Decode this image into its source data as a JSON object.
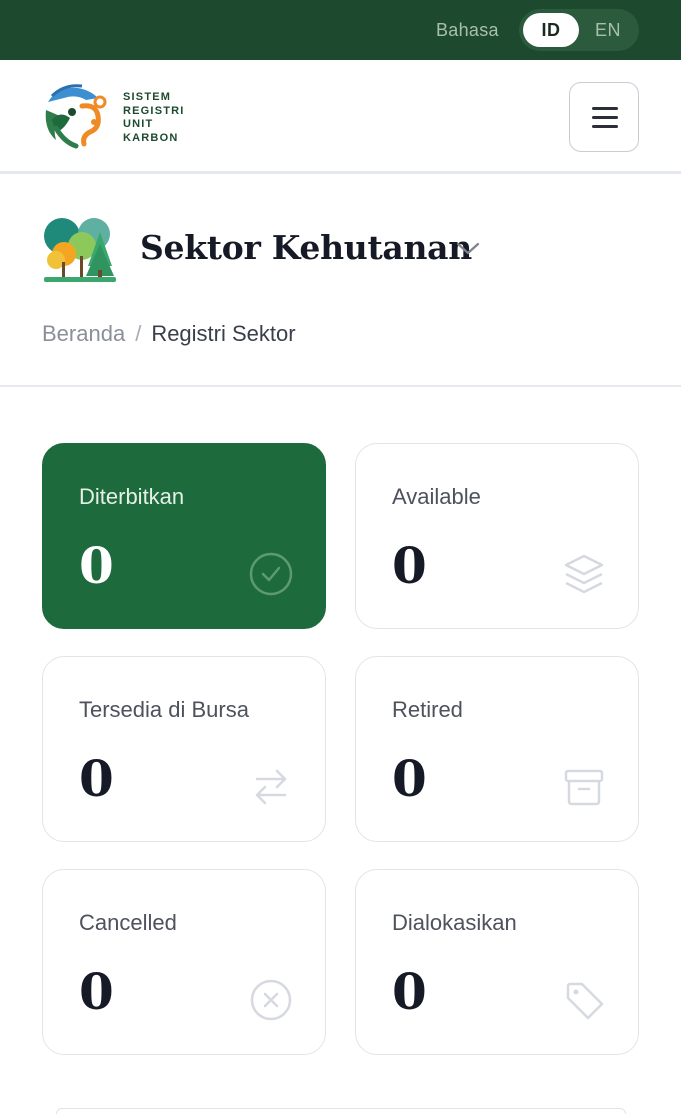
{
  "topbar": {
    "language_label": "Bahasa",
    "languages": [
      {
        "code": "ID",
        "active": true
      },
      {
        "code": "EN",
        "active": false
      }
    ]
  },
  "header": {
    "logo_lines": [
      "SISTEM",
      "REGISTRI",
      "UNIT",
      "KARBON"
    ],
    "menu_icon": "hamburger-icon"
  },
  "sector": {
    "title": "Sektor Kehutanan",
    "icon": "forest-trees-icon",
    "dropdown_icon": "chevron-down-icon"
  },
  "breadcrumb": {
    "home": "Beranda",
    "separator": "/",
    "current": "Registri Sektor"
  },
  "stats": [
    {
      "label": "Diterbitkan",
      "value": "0",
      "icon": "check-circle-icon"
    },
    {
      "label": "Available",
      "value": "0",
      "icon": "layers-icon"
    },
    {
      "label": "Tersedia di Bursa",
      "value": "0",
      "icon": "swap-arrows-icon"
    },
    {
      "label": "Retired",
      "value": "0",
      "icon": "archive-box-icon"
    },
    {
      "label": "Cancelled",
      "value": "0",
      "icon": "x-circle-icon"
    },
    {
      "label": "Dialokasikan",
      "value": "0",
      "icon": "tag-icon"
    }
  ],
  "colors": {
    "topbar": "#1d4a2f",
    "primary_card": "#1d6a3c",
    "text_dark": "#161a26"
  }
}
